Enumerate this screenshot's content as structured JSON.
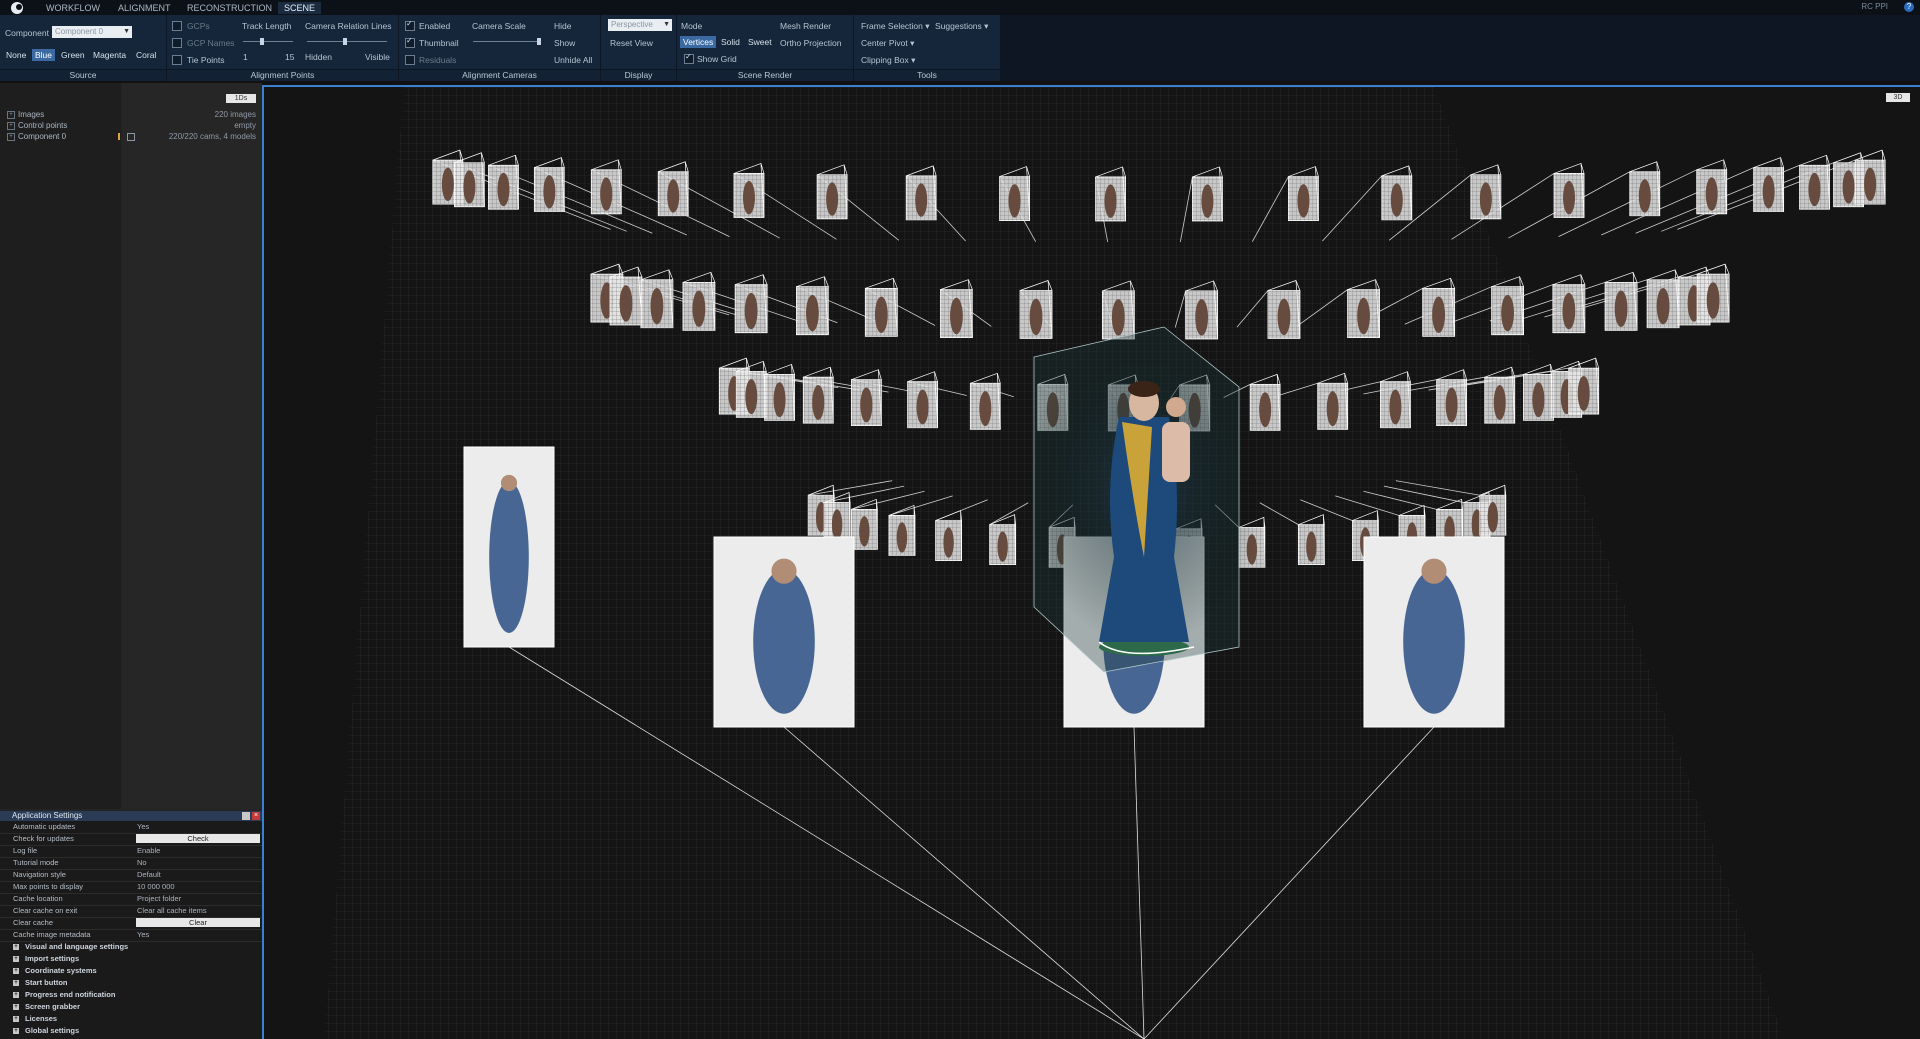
{
  "menu": {
    "tabs": [
      "WORKFLOW",
      "ALIGNMENT",
      "RECONSTRUCTION",
      "SCENE"
    ],
    "active_tab": "SCENE",
    "right_label": "RC PPI"
  },
  "source": {
    "title": "Source",
    "component_label": "Component",
    "component_value": "Component 0",
    "colors": [
      "None",
      "Blue",
      "Green",
      "Magenta",
      "Coral"
    ],
    "active_color": "Blue"
  },
  "alignment_points": {
    "title": "Alignment Points",
    "gcps": "GCPs",
    "gcp_names": "GCP Names",
    "tie_points": "Tie Points",
    "track_length": "Track Length",
    "track_min": "1",
    "track_max": "15",
    "camera_relation_lines": "Camera Relation Lines",
    "hidden": "Hidden",
    "visible": "Visible"
  },
  "alignment_cameras": {
    "title": "Alignment Cameras",
    "enabled": "Enabled",
    "thumbnail": "Thumbnail",
    "residuals": "Residuals",
    "camera_scale": "Camera Scale",
    "hide": "Hide",
    "show": "Show",
    "unhide_all": "Unhide All"
  },
  "display": {
    "title": "Display",
    "projection": "Perspective",
    "reset_view": "Reset View"
  },
  "scene_render": {
    "title": "Scene Render",
    "mode": "Mode",
    "modes": [
      "Vertices",
      "Solid",
      "Sweet"
    ],
    "active_mode": "Vertices",
    "show_grid": "Show Grid",
    "mesh_render": "Mesh Render",
    "ortho_projection": "Ortho Projection"
  },
  "tools": {
    "title": "Tools",
    "frame_selection": "Frame Selection",
    "suggestions": "Suggestions",
    "center_pivot": "Center Pivot",
    "clipping_box": "Clipping Box"
  },
  "tree": {
    "header_button": "1Ds",
    "rows": [
      {
        "name": "Images",
        "value": "220 images"
      },
      {
        "name": "Control points",
        "value": "empty"
      },
      {
        "name": "Component 0",
        "value": "220/220 cams, 4 models"
      }
    ]
  },
  "settings": {
    "title": "Application Settings",
    "rows": [
      {
        "key": "Automatic updates",
        "value": "Yes"
      },
      {
        "key": "Check for updates",
        "button": "Check"
      },
      {
        "key": "Log file",
        "value": "Enable"
      },
      {
        "key": "Tutorial mode",
        "value": "No"
      },
      {
        "key": "Navigation style",
        "value": "Default"
      },
      {
        "key": "Max points to display",
        "value": "10 000 000"
      },
      {
        "key": "Cache location",
        "value": "Project folder"
      },
      {
        "key": "Clear cache on exit",
        "value": "Clear all cache items"
      },
      {
        "key": "Clear cache",
        "button": "Clear"
      },
      {
        "key": "Cache image metadata",
        "value": "Yes"
      }
    ],
    "sections": [
      "Visual and language settings",
      "Import settings",
      "Coordinate systems",
      "Start button",
      "Progress end notification",
      "Screen grabber",
      "Licenses",
      "Global settings"
    ]
  },
  "viewport": {
    "mode_button": "3D"
  }
}
